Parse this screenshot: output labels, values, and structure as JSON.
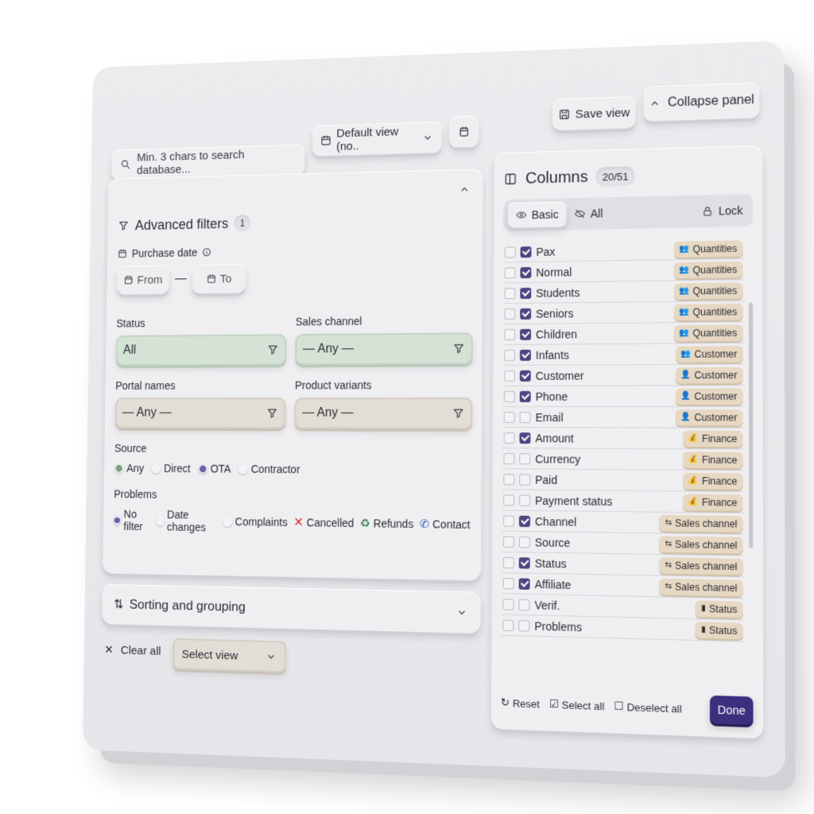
{
  "search": {
    "placeholder": "Min. 3 chars to search database..."
  },
  "view_select": {
    "value": "Default view (no.."
  },
  "toolbar": {
    "save_label": "Save view",
    "collapse_label": "Collapse panel"
  },
  "filters": {
    "title": "Advanced filters",
    "count": "1",
    "purchase_date": {
      "label": "Purchase date",
      "from": "From",
      "to": "To",
      "separator": "—"
    },
    "status": {
      "label": "Status",
      "value": "All"
    },
    "sales_channel": {
      "label": "Sales channel",
      "value": "— Any —"
    },
    "portal_names": {
      "label": "Portal names",
      "value": "— Any —"
    },
    "product_variants": {
      "label": "Product variants",
      "value": "— Any —"
    },
    "source": {
      "label": "Source",
      "options": [
        "Any",
        "Direct",
        "OTA",
        "Contractor"
      ]
    },
    "problems": {
      "label": "Problems",
      "options": [
        "No filter",
        "Date changes",
        "Complaints",
        "Cancelled",
        "Refunds",
        "Contact"
      ]
    }
  },
  "sorting": {
    "label": "Sorting and grouping"
  },
  "bottom": {
    "clear_all": "Clear all",
    "select_view": "Select view"
  },
  "columns": {
    "title": "Columns",
    "count": "20/51",
    "tabs": {
      "basic": "Basic",
      "all": "All",
      "lock": "Lock"
    },
    "items": [
      {
        "name": "Pax",
        "checked": true,
        "tag": "Quantities",
        "tag_icon": "people-icon"
      },
      {
        "name": "Normal",
        "checked": true,
        "tag": "Quantities",
        "tag_icon": "people-icon"
      },
      {
        "name": "Students",
        "checked": true,
        "tag": "Quantities",
        "tag_icon": "people-icon"
      },
      {
        "name": "Seniors",
        "checked": true,
        "tag": "Quantities",
        "tag_icon": "people-icon"
      },
      {
        "name": "Children",
        "checked": true,
        "tag": "Quantities",
        "tag_icon": "people-icon"
      },
      {
        "name": "Infants",
        "checked": true,
        "tag": "Customer",
        "tag_icon": "people-icon"
      },
      {
        "name": "Customer",
        "checked": true,
        "tag": "Customer",
        "tag_icon": "person-icon"
      },
      {
        "name": "Phone",
        "checked": true,
        "tag": "Customer",
        "tag_icon": "person-icon"
      },
      {
        "name": "Email",
        "checked": false,
        "tag": "Customer",
        "tag_icon": "person-icon"
      },
      {
        "name": "Amount",
        "checked": true,
        "tag": "Finance",
        "tag_icon": "money-icon"
      },
      {
        "name": "Currency",
        "checked": false,
        "tag": "Finance",
        "tag_icon": "money-icon"
      },
      {
        "name": "Paid",
        "checked": false,
        "tag": "Finance",
        "tag_icon": "money-icon"
      },
      {
        "name": "Payment status",
        "checked": false,
        "tag": "Finance",
        "tag_icon": "money-icon"
      },
      {
        "name": "Channel",
        "checked": true,
        "tag": "Sales channel",
        "tag_icon": "split-icon"
      },
      {
        "name": "Source",
        "checked": false,
        "tag": "Sales channel",
        "tag_icon": "split-icon"
      },
      {
        "name": "Status",
        "checked": true,
        "tag": "Sales channel",
        "tag_icon": "split-icon"
      },
      {
        "name": "Affiliate",
        "checked": true,
        "tag": "Sales channel",
        "tag_icon": "split-icon"
      },
      {
        "name": "Verif.",
        "checked": false,
        "tag": "Status",
        "tag_icon": "bars-icon"
      },
      {
        "name": "Problems",
        "checked": false,
        "tag": "Status",
        "tag_icon": "bars-icon"
      }
    ],
    "footer": {
      "reset": "Reset",
      "select_all": "Select all",
      "deselect_all": "Deselect all",
      "done": "Done"
    }
  },
  "colors": {
    "accent": "#3b2f7e",
    "green_field": "#d5e3d6",
    "beige_field": "#e2ddd5",
    "tag": "#e6d8c3",
    "cancel": "#d62b2b",
    "refund": "#3f8a55",
    "contact": "#2f63b5"
  }
}
